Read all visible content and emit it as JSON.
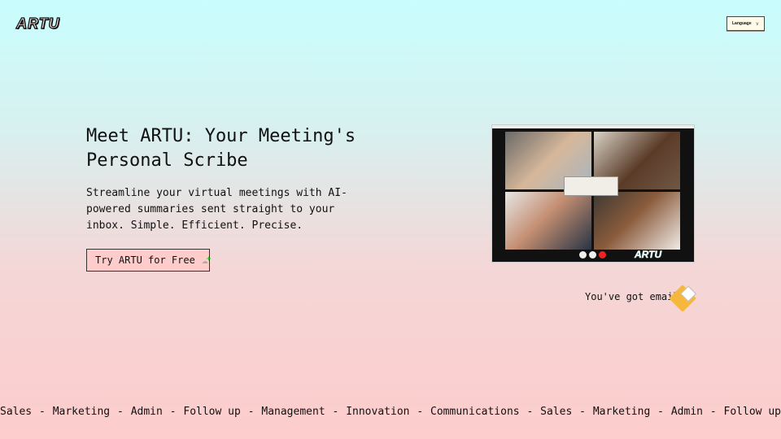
{
  "header": {
    "logo": "ARTU",
    "language_label": "Language",
    "chevron_icon": "chevron-down-icon"
  },
  "hero": {
    "title": "Meet ARTU: Your Meeting's Personal Scribe",
    "subtitle": "Streamline your virtual meetings with AI-powered summaries sent straight to your inbox. Simple. Efficient. Precise.",
    "cta_label": "Try ARTU for Free",
    "cta_icon": "cloud-upload-icon"
  },
  "preview": {
    "logo": "ARTU"
  },
  "email": {
    "label": "You've got email",
    "icon": "envelope-icon"
  },
  "marquee": {
    "separator": "-",
    "items": [
      "Sales",
      "Marketing",
      "Admin",
      "Follow up",
      "Management",
      "Innovation",
      "Communications",
      "Sales",
      "Marketing",
      "Admin",
      "Follow up"
    ]
  },
  "colors": {
    "bg_top": "#c8fefe",
    "bg_bottom": "#fdcccc",
    "cta_bg": "#ffcccc"
  }
}
